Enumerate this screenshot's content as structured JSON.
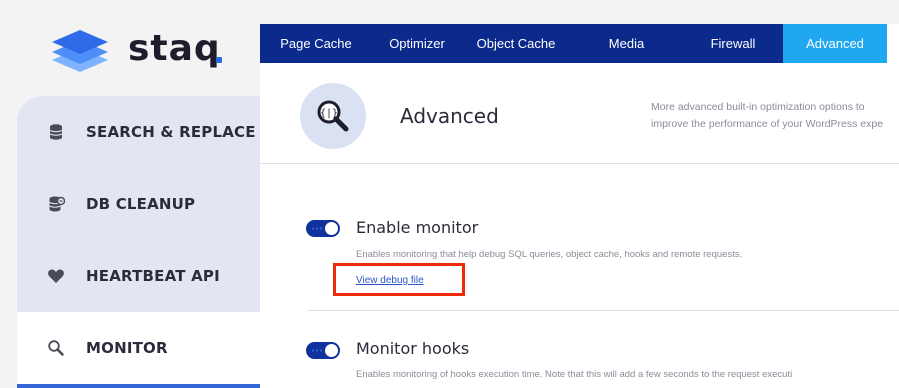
{
  "brand": {
    "name": "staq",
    "accent": "#3566d6"
  },
  "sidebar": {
    "items": [
      {
        "label": "SEARCH & REPLACE",
        "icon": "database-icon"
      },
      {
        "label": "DB CLEANUP",
        "icon": "database-clean-icon"
      },
      {
        "label": "HEARTBEAT API",
        "icon": "heart-icon"
      },
      {
        "label": "MONITOR",
        "icon": "magnifier-icon",
        "active": true
      }
    ]
  },
  "nav": {
    "tabs": [
      {
        "label": "Page Cache"
      },
      {
        "label": "Optimizer"
      },
      {
        "label": "Object Cache"
      },
      {
        "label": "Media"
      },
      {
        "label": "Firewall"
      },
      {
        "label": "Advanced",
        "active": true
      }
    ],
    "bg_color": "#0c2a8c",
    "active_color": "#1fa7f0"
  },
  "header": {
    "title": "Advanced",
    "description_line1": "More advanced built-in optimization options to",
    "description_line2": "improve the performance of your WordPress expe",
    "icon": "code-search-icon"
  },
  "settings": [
    {
      "title": "Enable monitor",
      "enabled": true,
      "description": "Enables monitoring that help debug SQL queries, object cache, hooks and remote requests.",
      "link": "View debug file"
    },
    {
      "title": "Monitor hooks",
      "enabled": true,
      "description": "Enables monitoring of hooks execution time. Note that this will add a few seconds to the request executi"
    }
  ]
}
